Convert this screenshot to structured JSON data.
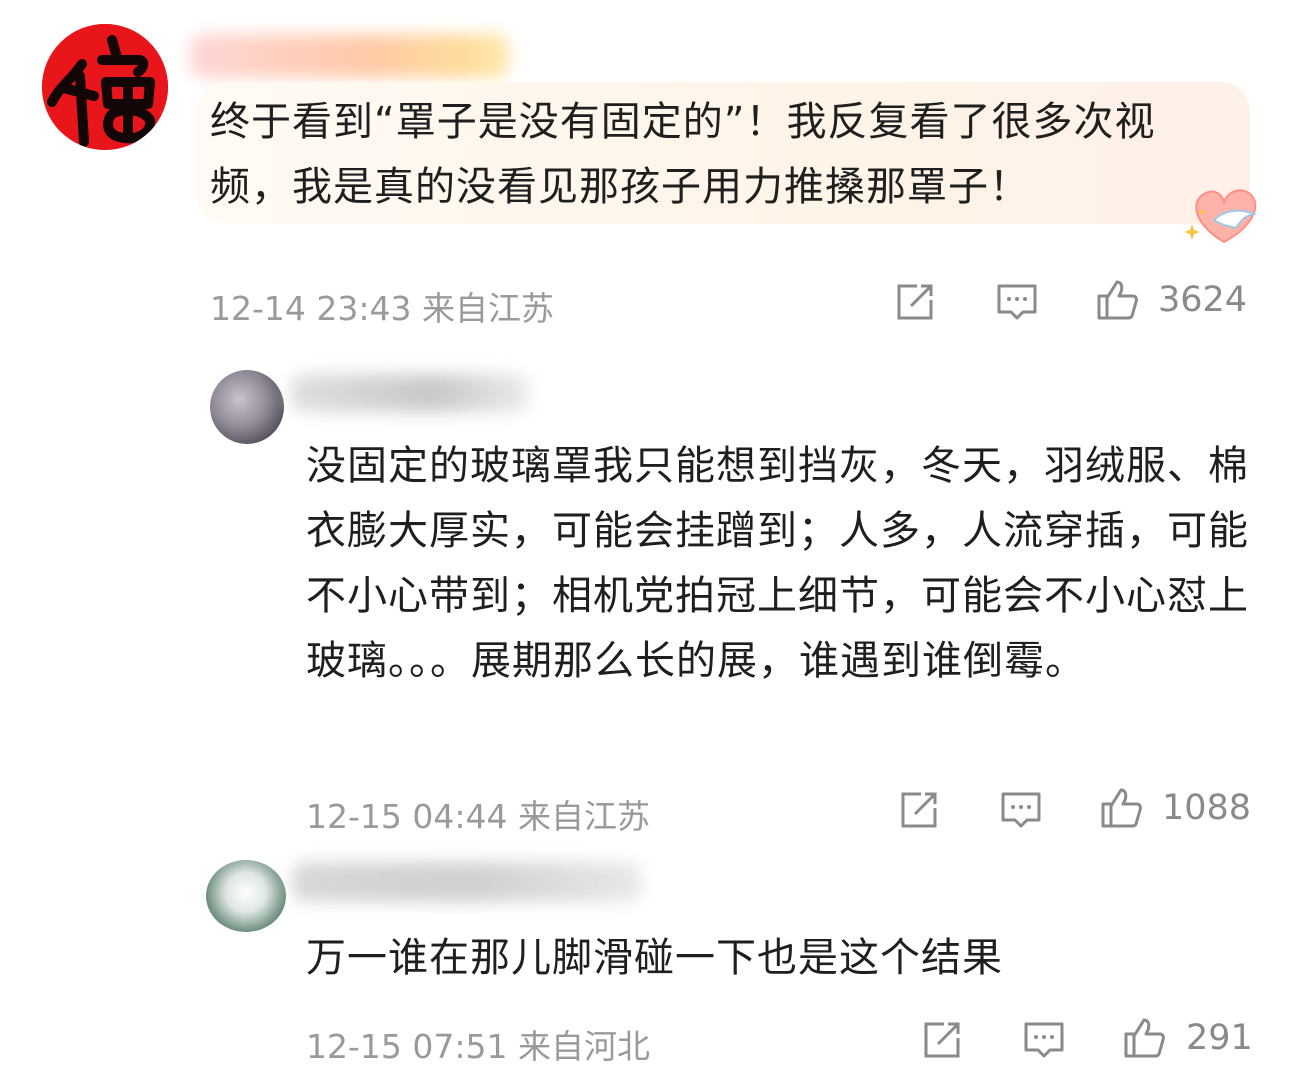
{
  "comments": [
    {
      "text": "终于看到“罩子是没有固定的”！我反复看了很多次视频，我是真的没看见那孩子用力推搡那罩子！",
      "date": "12-14 23:43",
      "location": "来自江苏",
      "likes": "3624",
      "highlighted": true
    },
    {
      "text": "没固定的玻璃罩我只能想到挡灰，冬天，羽绒服、棉衣膨大厚实，可能会挂蹭到；人多，人流穿插，可能不小心带到；相机党拍冠上细节，可能会不小心怼上玻璃。。。展期那么长的展，谁遇到谁倒霉。",
      "date": "12-15 04:44",
      "location": "来自江苏",
      "likes": "1088"
    },
    {
      "text": "万一谁在那儿脚滑碰一下也是这个结果",
      "date": "12-15 07:51",
      "location": "来自河北",
      "likes": "291"
    }
  ],
  "icons": {
    "share": "share-icon",
    "comment": "comment-icon",
    "like": "thumbs-up-icon"
  },
  "colors": {
    "avatar_red": "#e8151b",
    "meta_gray": "#9a9a9a",
    "icon_gray": "#8a8a8a",
    "highlight_bg": "#fff4e8"
  }
}
